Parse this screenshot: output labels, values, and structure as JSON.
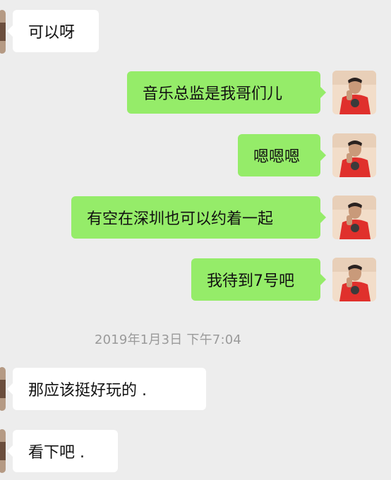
{
  "timestamp": "2019年1月3日 下午7:04",
  "messages": [
    {
      "sender": "contact",
      "text": "可以呀"
    },
    {
      "sender": "self",
      "text": "音乐总监是我哥们儿"
    },
    {
      "sender": "self",
      "text": "嗯嗯嗯"
    },
    {
      "sender": "self",
      "text": "有空在深圳也可以约着一起"
    },
    {
      "sender": "self",
      "text": "我待到7号吧"
    },
    {
      "sender": "contact",
      "text": "那应该挺好玩的 ."
    },
    {
      "sender": "contact",
      "text": "看下吧 ."
    }
  ],
  "icons": {
    "self_avatar": "self-avatar-icon",
    "contact_avatar": "contact-avatar-icon"
  },
  "colors": {
    "background": "#ededed",
    "self_bubble": "#95ec69",
    "contact_bubble": "#ffffff",
    "timestamp_text": "#9a9a9a"
  }
}
